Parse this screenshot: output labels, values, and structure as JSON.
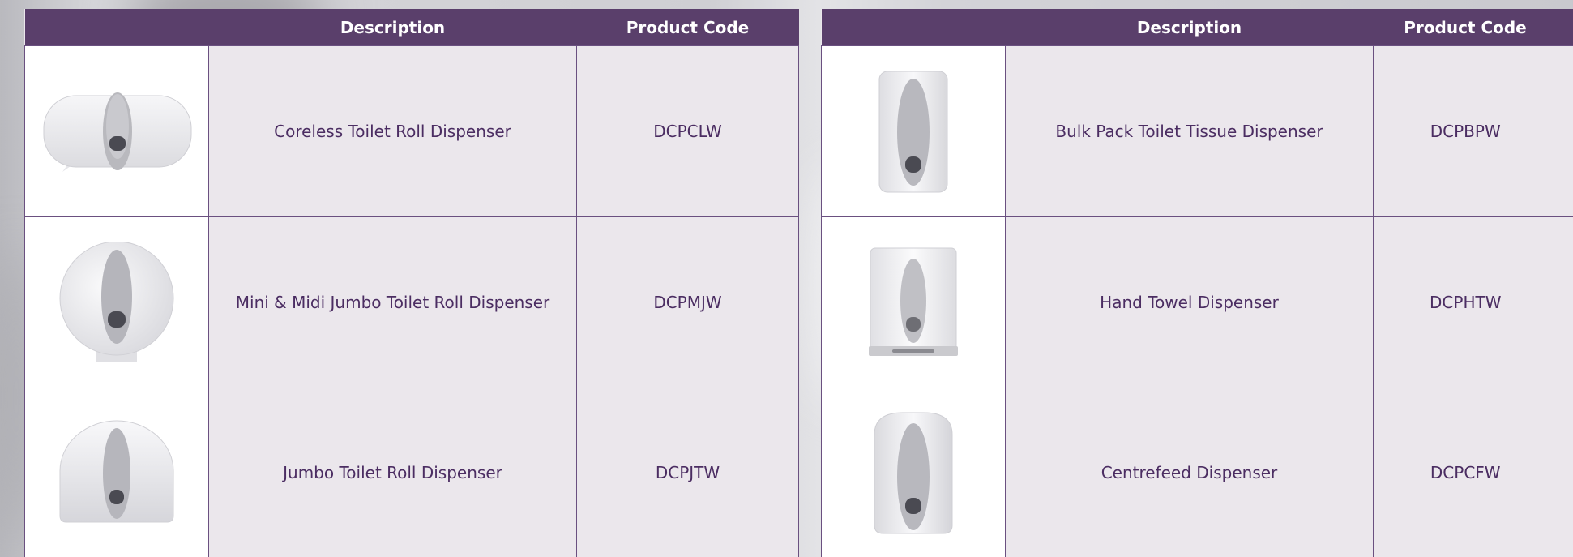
{
  "tables": [
    {
      "headers": [
        "",
        "Description",
        "Product Code"
      ],
      "rows": [
        {
          "product_icon": "coreless-dispenser-icon",
          "description": "Coreless Toilet Roll Dispenser",
          "code": "DCPCLW"
        },
        {
          "product_icon": "mini-midi-jumbo-dispenser-icon",
          "description": "Mini & Midi Jumbo Toilet Roll Dispenser",
          "code": "DCPMJW"
        },
        {
          "product_icon": "jumbo-dispenser-icon",
          "description": "Jumbo Toilet Roll Dispenser",
          "code": "DCPJTW"
        }
      ]
    },
    {
      "headers": [
        "",
        "Description",
        "Product Code"
      ],
      "rows": [
        {
          "product_icon": "bulk-pack-dispenser-icon",
          "description": "Bulk Pack Toilet Tissue Dispenser",
          "code": "DCPBPW"
        },
        {
          "product_icon": "hand-towel-dispenser-icon",
          "description": "Hand Towel Dispenser",
          "code": "DCPHTW"
        },
        {
          "product_icon": "centrefeed-dispenser-icon",
          "description": "Centrefeed Dispenser",
          "code": "DCPCFW"
        }
      ]
    }
  ],
  "colors": {
    "header_bg": "#5a3f6b",
    "cell_bg": "#ebe7ec",
    "text": "#4b2d62",
    "border": "#6a5080"
  }
}
